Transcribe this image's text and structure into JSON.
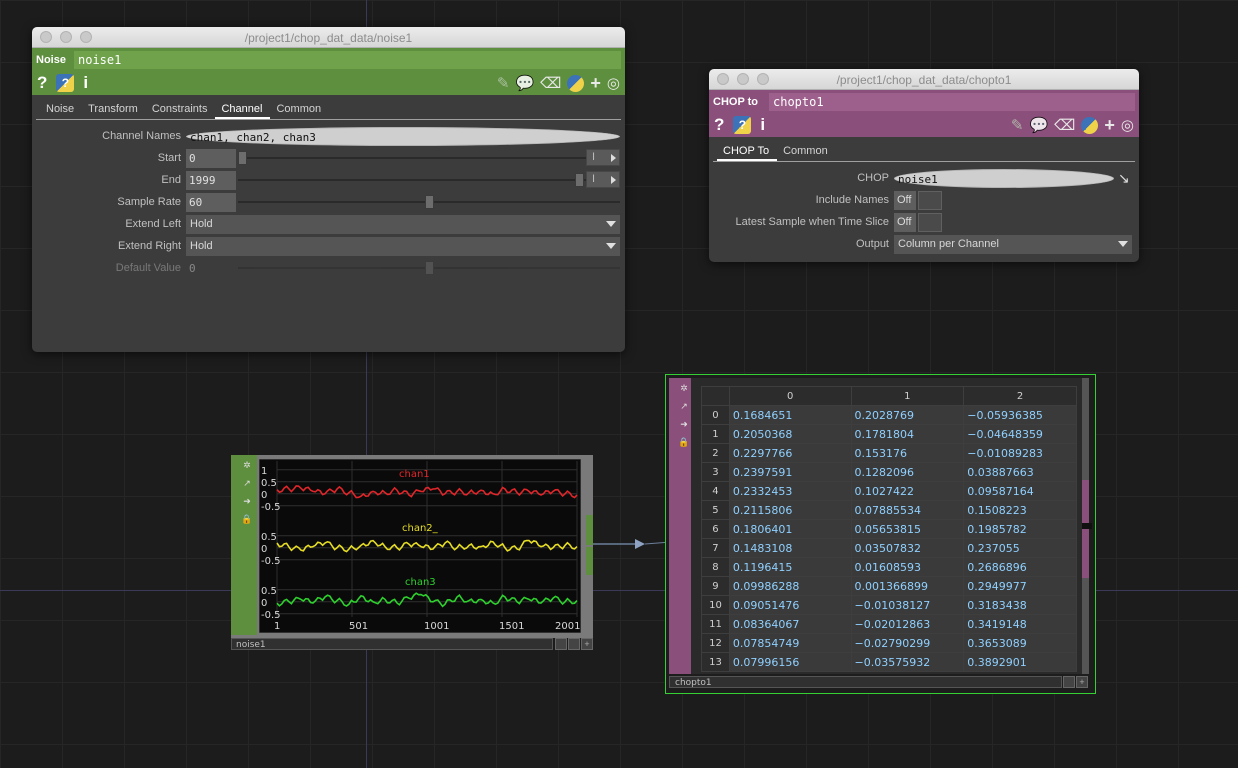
{
  "noise_window": {
    "title": "/project1/chop_dat_data/noise1",
    "op_type": "Noise",
    "op_name": "noise1",
    "tabs": [
      "Noise",
      "Transform",
      "Constraints",
      "Channel",
      "Common"
    ],
    "active_tab": "Channel",
    "params": {
      "channel_names_label": "Channel Names",
      "channel_names_value": "chan1, chan2, chan3",
      "start_label": "Start",
      "start_value": "0",
      "end_label": "End",
      "end_value": "1999",
      "sample_rate_label": "Sample Rate",
      "sample_rate_value": "60",
      "extend_left_label": "Extend Left",
      "extend_left_value": "Hold",
      "extend_right_label": "Extend Right",
      "extend_right_value": "Hold",
      "default_value_label": "Default Value",
      "default_value_value": "0",
      "unit_button": "I"
    },
    "header_color": "#5e8f3e"
  },
  "chopto_window": {
    "title": "/project1/chop_dat_data/chopto1",
    "op_type": "CHOP to",
    "op_name": "chopto1",
    "tabs": [
      "CHOP To",
      "Common"
    ],
    "active_tab": "CHOP To",
    "params": {
      "chop_label": "CHOP",
      "chop_value": "noise1",
      "include_names_label": "Include Names",
      "include_names_value": "Off",
      "latest_sample_label": "Latest Sample when Time Slice",
      "latest_sample_value": "Off",
      "output_label": "Output",
      "output_value": "Column per Channel"
    },
    "header_color": "#8a4f7a"
  },
  "noise_node": {
    "name": "noise1",
    "y_ticks": [
      "1",
      "0.5",
      "0",
      "-0.5"
    ],
    "x_ticks": [
      "1",
      "501",
      "1001",
      "1501",
      "2001"
    ],
    "channels": [
      {
        "name": "chan1",
        "color": "#e0262a"
      },
      {
        "name": "chan2_",
        "color": "#e6dd24"
      },
      {
        "name": "chan3",
        "color": "#2ed12e"
      }
    ],
    "chart_data": {
      "type": "line",
      "x": [
        1,
        81,
        161,
        241,
        321,
        401,
        481,
        561,
        641,
        721,
        801,
        881,
        961,
        1041,
        1121,
        1201,
        1281,
        1361,
        1441,
        1521,
        1601,
        1681,
        1761,
        1841,
        1921,
        2001
      ],
      "series": [
        {
          "name": "chan1",
          "values": [
            0.17,
            0.2,
            0.23,
            0.1,
            0.0,
            0.2,
            0.05,
            -0.1,
            0.1,
            0.05,
            0.15,
            -0.05,
            0.1,
            0.2,
            0.0,
            0.1,
            0.05,
            0.15,
            0.0,
            0.2,
            0.05,
            0.1,
            -0.05,
            0.1,
            0.0,
            -0.05
          ]
        },
        {
          "name": "chan2",
          "values": [
            0.2,
            0.03,
            -0.1,
            0.05,
            0.2,
            0.0,
            -0.05,
            0.1,
            0.3,
            0.05,
            0.0,
            0.15,
            0.05,
            -0.05,
            0.2,
            0.0,
            0.1,
            0.05,
            0.25,
            0.0,
            -0.05,
            0.3,
            0.05,
            0.0,
            0.1,
            0.05
          ]
        },
        {
          "name": "chan3",
          "values": [
            -0.06,
            0.0,
            0.1,
            -0.05,
            0.2,
            0.05,
            -0.1,
            0.25,
            0.0,
            0.1,
            -0.05,
            0.15,
            0.3,
            0.0,
            -0.1,
            0.2,
            0.05,
            0.1,
            -0.05,
            0.2,
            0.0,
            0.1,
            -0.05,
            0.15,
            0.0,
            0.05
          ]
        }
      ],
      "ylim": [
        -0.8,
        1.2
      ]
    }
  },
  "chopto_node": {
    "name": "chopto1",
    "columns": [
      "0",
      "1",
      "2"
    ],
    "rows": [
      {
        "idx": "0",
        "c0": "0.1684651",
        "c1": "0.2028769",
        "c2": "−0.05936385"
      },
      {
        "idx": "1",
        "c0": "0.2050368",
        "c1": "0.1781804",
        "c2": "−0.04648359"
      },
      {
        "idx": "2",
        "c0": "0.2297766",
        "c1": "0.153176",
        "c2": "−0.01089283"
      },
      {
        "idx": "3",
        "c0": "0.2397591",
        "c1": "0.1282096",
        "c2": "0.03887663"
      },
      {
        "idx": "4",
        "c0": "0.2332453",
        "c1": "0.1027422",
        "c2": "0.09587164"
      },
      {
        "idx": "5",
        "c0": "0.2115806",
        "c1": "0.07885534",
        "c2": "0.1508223"
      },
      {
        "idx": "6",
        "c0": "0.1806401",
        "c1": "0.05653815",
        "c2": "0.1985782"
      },
      {
        "idx": "7",
        "c0": "0.1483108",
        "c1": "0.03507832",
        "c2": "0.237055"
      },
      {
        "idx": "8",
        "c0": "0.1196415",
        "c1": "0.01608593",
        "c2": "0.2686896"
      },
      {
        "idx": "9",
        "c0": "0.09986288",
        "c1": "0.001366899",
        "c2": "0.2949977"
      },
      {
        "idx": "10",
        "c0": "0.09051476",
        "c1": "−0.01038127",
        "c2": "0.3183438"
      },
      {
        "idx": "11",
        "c0": "0.08364067",
        "c1": "−0.02012863",
        "c2": "0.3419148"
      },
      {
        "idx": "12",
        "c0": "0.07854749",
        "c1": "−0.02790299",
        "c2": "0.3653089"
      },
      {
        "idx": "13",
        "c0": "0.07996156",
        "c1": "−0.03575932",
        "c2": "0.3892901"
      }
    ]
  },
  "icons": {
    "help": "?",
    "python_help": "?",
    "info": "i",
    "add": "+"
  }
}
